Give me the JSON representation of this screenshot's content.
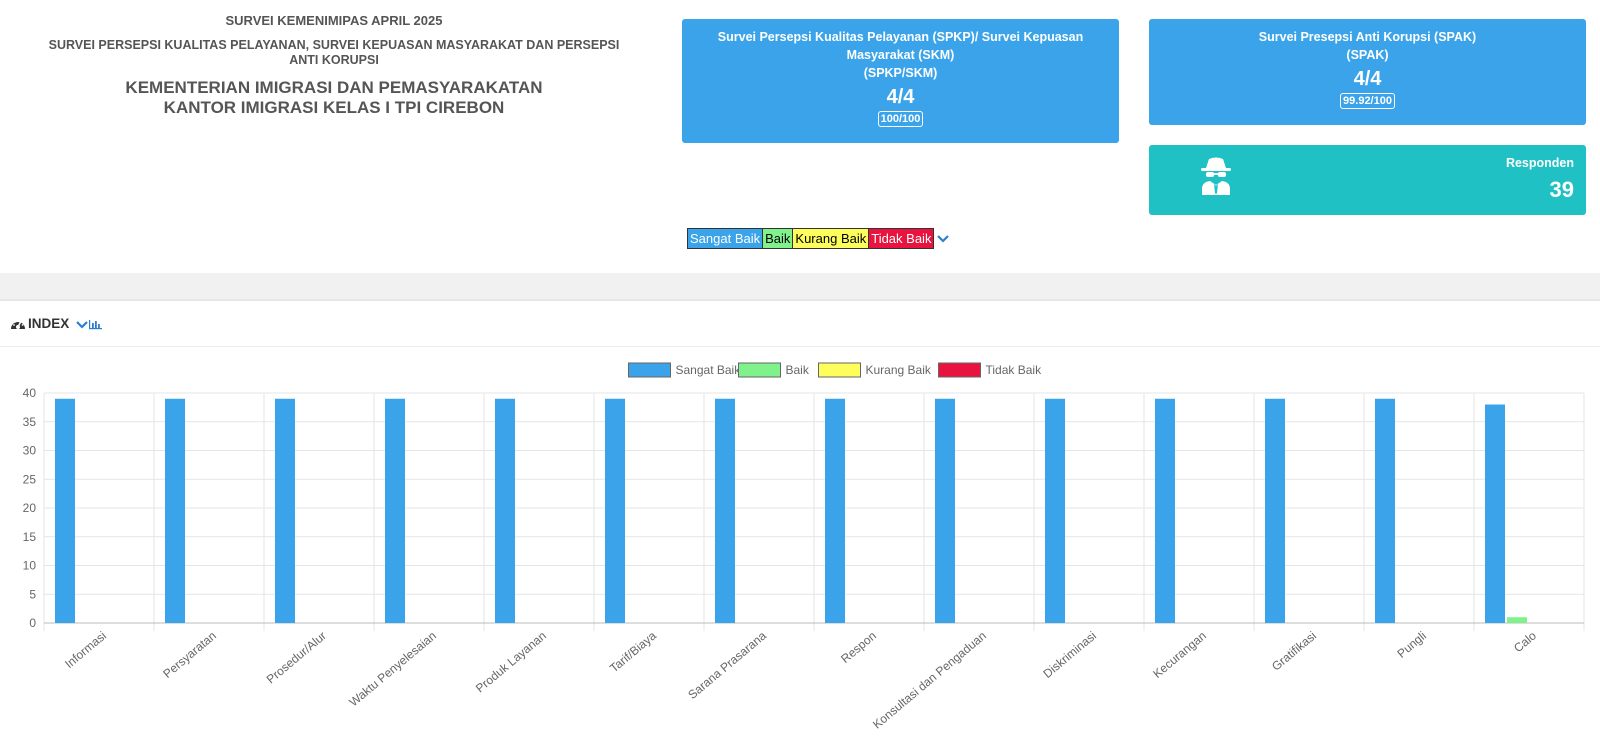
{
  "header": {
    "line1": "SURVEI KEMENIMIPAS APRIL 2025",
    "line2a": "SURVEI PERSEPSI KUALITAS PELAYANAN, SURVEI KEPUASAN MASYARAKAT DAN PERSEPSI",
    "line2b": "ANTI KORUPSI",
    "line3a": "KEMENTERIAN IMIGRASI DAN PEMASYARAKATAN",
    "line3b": "KANTOR IMIGRASI KELAS I TPI CIREBON"
  },
  "cards": {
    "spkp": {
      "title_a": "Survei Persepsi Kualitas Pelayanan (SPKP)/ Survei Kepuasan",
      "title_b": "Masyarakat (SKM)",
      "title_c": "(SPKP/SKM)",
      "score": "4/4",
      "value": "100/100"
    },
    "spak": {
      "title_a": "Survei Presepsi Anti Korupsi (SPAK)",
      "title_b": "(SPAK)",
      "score": "4/4",
      "value": "99.92/100"
    },
    "responden": {
      "label": "Responden",
      "value": "39",
      "icon": "spy-icon"
    }
  },
  "legend_keys": {
    "sangat_baik": "Sangat Baik",
    "baik": "Baik",
    "kurang_baik": "Kurang Baik",
    "tidak_baik": "Tidak Baik"
  },
  "panel": {
    "title": "INDEX",
    "icon": "dashboard-icon"
  },
  "colors": {
    "sangat_baik": "#3aa3e9",
    "baik": "#7ff28c",
    "kurang_baik": "#fdfd5b",
    "tidak_baik": "#e8143f",
    "card_blue": "#3aa3e9",
    "card_teal": "#20c1c5"
  },
  "chart_data": {
    "type": "bar",
    "categories": [
      "Informasi",
      "Persyaratan",
      "Prosedur/Alur",
      "Waktu Penyelesaian",
      "Produk Layanan",
      "Tarif/Biaya",
      "Sarana Prasarana",
      "Respon",
      "Konsultasi dan Pengaduan",
      "Diskriminasi",
      "Kecurangan",
      "Gratifikasi",
      "Pungli",
      "Calo"
    ],
    "series": [
      {
        "name": "Sangat Baik",
        "color": "#3aa3e9",
        "values": [
          39,
          39,
          39,
          39,
          39,
          39,
          39,
          39,
          39,
          39,
          39,
          39,
          39,
          38
        ]
      },
      {
        "name": "Baik",
        "color": "#7ff28c",
        "values": [
          0,
          0,
          0,
          0,
          0,
          0,
          0,
          0,
          0,
          0,
          0,
          0,
          0,
          1
        ]
      },
      {
        "name": "Kurang Baik",
        "color": "#fdfd5b",
        "values": [
          0,
          0,
          0,
          0,
          0,
          0,
          0,
          0,
          0,
          0,
          0,
          0,
          0,
          0
        ]
      },
      {
        "name": "Tidak Baik",
        "color": "#e8143f",
        "values": [
          0,
          0,
          0,
          0,
          0,
          0,
          0,
          0,
          0,
          0,
          0,
          0,
          0,
          0
        ]
      }
    ],
    "ylim": [
      0,
      40
    ],
    "yticks": [
      0,
      5,
      10,
      15,
      20,
      25,
      30,
      35,
      40
    ],
    "grid": true,
    "legend_position": "top-center"
  }
}
